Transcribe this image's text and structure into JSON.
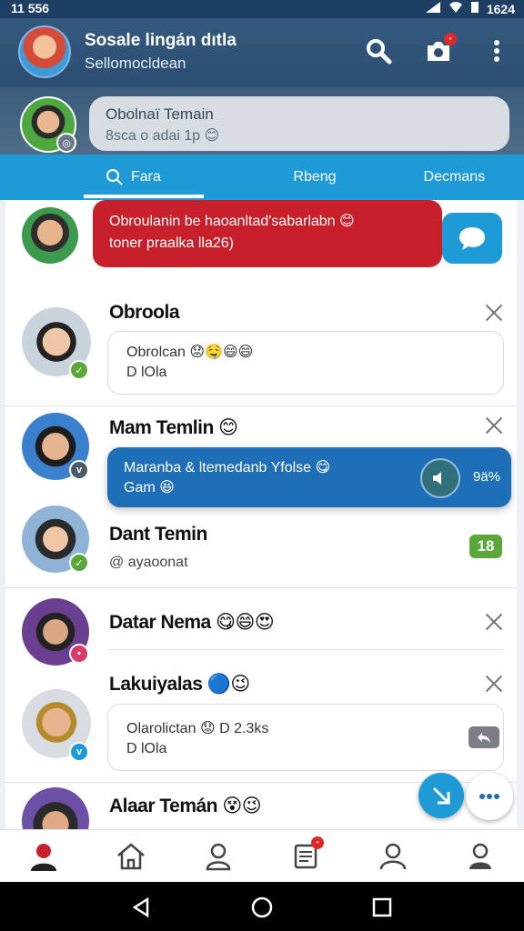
{
  "status": {
    "time": "11 556",
    "battery": "1624"
  },
  "header": {
    "title": "Sosale lingán dıtla",
    "subtitle": "Sellomocldean"
  },
  "story": {
    "name": "Obolnaï Temain",
    "status": "8sca o adai 1p"
  },
  "tabs": [
    {
      "label": "Fara"
    },
    {
      "label": "Rbeng"
    },
    {
      "label": "Decmans"
    }
  ],
  "alert": {
    "line1": "Obroulanin be haoanltad'sabarlabn",
    "line2": "toner praalka lla26)"
  },
  "chats": [
    {
      "name": "Obroola",
      "msg1": "Obrolcan",
      "msg2": "D lOla"
    },
    {
      "name": "Mam Temlin",
      "highlight1": "Maranba & ltemedanb Yfolse",
      "highlight2": "Gam",
      "highlight_meta": "9ä%"
    },
    {
      "name": "Dant Temin",
      "preview": "@ ayaoonat",
      "count": "18"
    },
    {
      "name": "Datar Nema"
    },
    {
      "name": "Lakuiyalas",
      "msg1": "Olarolictan",
      "msg1_meta": "D 2.3ks",
      "msg2": "D lOla"
    },
    {
      "name": "Alaar Temán"
    }
  ],
  "colors": {
    "primary": "#1e9ad6",
    "appbar": "#2c4d72",
    "alert": "#c8202a",
    "highlight": "#1f6fb8",
    "badge_green": "#5aa83a"
  }
}
